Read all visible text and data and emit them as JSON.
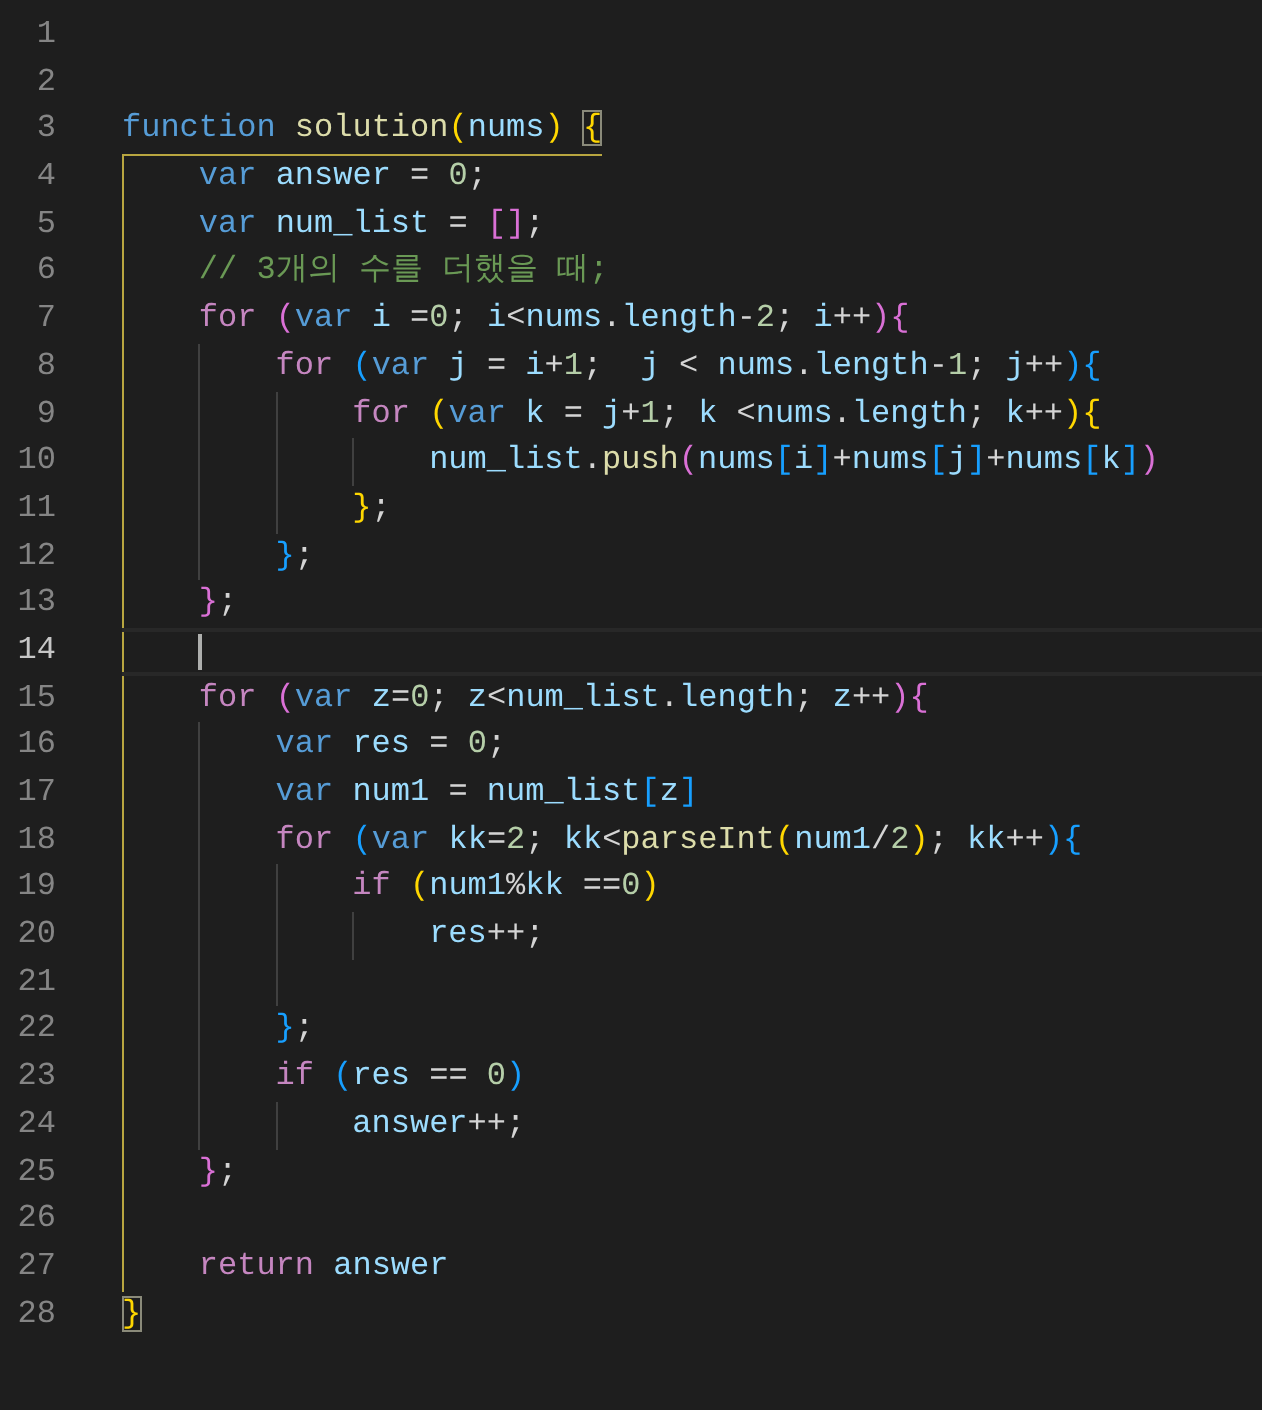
{
  "editor": {
    "lines": [
      {
        "number": "1",
        "current": false
      },
      {
        "number": "2",
        "current": false
      },
      {
        "number": "3",
        "current": false,
        "tokens": [
          {
            "kind": "storage",
            "text": "function"
          },
          {
            "kind": "space"
          },
          {
            "kind": "function",
            "text": "solution"
          },
          {
            "kind": "paren1",
            "text": "("
          },
          {
            "kind": "variable",
            "text": "nums"
          },
          {
            "kind": "paren1",
            "text": ")"
          },
          {
            "kind": "space"
          },
          {
            "kind": "paren1",
            "text": "{",
            "matched": true
          }
        ],
        "children": [
          {
            "number": "4",
            "current": false,
            "tokens": [
              {
                "kind": "storage",
                "text": "var"
              },
              {
                "kind": "space"
              },
              {
                "kind": "variable",
                "text": "answer"
              },
              {
                "kind": "plain",
                "text": " = "
              },
              {
                "kind": "number",
                "text": "0"
              },
              {
                "kind": "plain",
                "text": ";"
              }
            ]
          },
          {
            "number": "5",
            "current": false,
            "tokens": [
              {
                "kind": "storage",
                "text": "var"
              },
              {
                "kind": "space"
              },
              {
                "kind": "variable",
                "text": "num_list"
              },
              {
                "kind": "plain",
                "text": " = "
              },
              {
                "kind": "paren2",
                "text": "[]"
              },
              {
                "kind": "plain",
                "text": ";"
              }
            ]
          },
          {
            "number": "6",
            "current": false,
            "tokens": [
              {
                "kind": "comment",
                "text": "// 3개의 수를 더했을 때;"
              }
            ]
          },
          {
            "number": "7",
            "current": false,
            "tokens": [
              {
                "kind": "control",
                "text": "for"
              },
              {
                "kind": "space"
              },
              {
                "kind": "paren2",
                "text": "("
              },
              {
                "kind": "storage",
                "text": "var"
              },
              {
                "kind": "space"
              },
              {
                "kind": "variable",
                "text": "i"
              },
              {
                "kind": "plain",
                "text": " ="
              },
              {
                "kind": "number",
                "text": "0"
              },
              {
                "kind": "plain",
                "text": "; "
              },
              {
                "kind": "variable",
                "text": "i"
              },
              {
                "kind": "plain",
                "text": "<"
              },
              {
                "kind": "variable",
                "text": "nums"
              },
              {
                "kind": "plain",
                "text": "."
              },
              {
                "kind": "variable",
                "text": "length"
              },
              {
                "kind": "plain",
                "text": "-"
              },
              {
                "kind": "number",
                "text": "2"
              },
              {
                "kind": "plain",
                "text": "; "
              },
              {
                "kind": "variable",
                "text": "i"
              },
              {
                "kind": "plain",
                "text": "++"
              },
              {
                "kind": "paren2",
                "text": "){"
              }
            ],
            "children": [
              {
                "number": "8",
                "current": false,
                "tokens": [
                  {
                    "kind": "control",
                    "text": "for"
                  },
                  {
                    "kind": "space"
                  },
                  {
                    "kind": "paren3",
                    "text": "("
                  },
                  {
                    "kind": "storage",
                    "text": "var"
                  },
                  {
                    "kind": "space"
                  },
                  {
                    "kind": "variable",
                    "text": "j"
                  },
                  {
                    "kind": "plain",
                    "text": " = "
                  },
                  {
                    "kind": "variable",
                    "text": "i"
                  },
                  {
                    "kind": "plain",
                    "text": "+"
                  },
                  {
                    "kind": "number",
                    "text": "1"
                  },
                  {
                    "kind": "plain",
                    "text": ";  "
                  },
                  {
                    "kind": "variable",
                    "text": "j"
                  },
                  {
                    "kind": "plain",
                    "text": " < "
                  },
                  {
                    "kind": "variable",
                    "text": "nums"
                  },
                  {
                    "kind": "plain",
                    "text": "."
                  },
                  {
                    "kind": "variable",
                    "text": "length"
                  },
                  {
                    "kind": "plain",
                    "text": "-"
                  },
                  {
                    "kind": "number",
                    "text": "1"
                  },
                  {
                    "kind": "plain",
                    "text": "; "
                  },
                  {
                    "kind": "variable",
                    "text": "j"
                  },
                  {
                    "kind": "plain",
                    "text": "++"
                  },
                  {
                    "kind": "paren3",
                    "text": "){"
                  }
                ],
                "children": [
                  {
                    "number": "9",
                    "current": false,
                    "tokens": [
                      {
                        "kind": "control",
                        "text": "for"
                      },
                      {
                        "kind": "space"
                      },
                      {
                        "kind": "paren1",
                        "text": "("
                      },
                      {
                        "kind": "storage",
                        "text": "var"
                      },
                      {
                        "kind": "space"
                      },
                      {
                        "kind": "variable",
                        "text": "k"
                      },
                      {
                        "kind": "plain",
                        "text": " = "
                      },
                      {
                        "kind": "variable",
                        "text": "j"
                      },
                      {
                        "kind": "plain",
                        "text": "+"
                      },
                      {
                        "kind": "number",
                        "text": "1"
                      },
                      {
                        "kind": "plain",
                        "text": "; "
                      },
                      {
                        "kind": "variable",
                        "text": "k"
                      },
                      {
                        "kind": "plain",
                        "text": " <"
                      },
                      {
                        "kind": "variable",
                        "text": "nums"
                      },
                      {
                        "kind": "plain",
                        "text": "."
                      },
                      {
                        "kind": "variable",
                        "text": "length"
                      },
                      {
                        "kind": "plain",
                        "text": "; "
                      },
                      {
                        "kind": "variable",
                        "text": "k"
                      },
                      {
                        "kind": "plain",
                        "text": "++"
                      },
                      {
                        "kind": "paren1",
                        "text": "){"
                      }
                    ],
                    "children": [
                      {
                        "number": "10",
                        "current": false,
                        "tokens": [
                          {
                            "kind": "variable",
                            "text": "num_list"
                          },
                          {
                            "kind": "plain",
                            "text": "."
                          },
                          {
                            "kind": "function",
                            "text": "push"
                          },
                          {
                            "kind": "paren2",
                            "text": "("
                          },
                          {
                            "kind": "variable",
                            "text": "nums"
                          },
                          {
                            "kind": "paren3",
                            "text": "["
                          },
                          {
                            "kind": "variable",
                            "text": "i"
                          },
                          {
                            "kind": "paren3",
                            "text": "]"
                          },
                          {
                            "kind": "plain",
                            "text": "+"
                          },
                          {
                            "kind": "variable",
                            "text": "nums"
                          },
                          {
                            "kind": "paren3",
                            "text": "["
                          },
                          {
                            "kind": "variable",
                            "text": "j"
                          },
                          {
                            "kind": "paren3",
                            "text": "]"
                          },
                          {
                            "kind": "plain",
                            "text": "+"
                          },
                          {
                            "kind": "variable",
                            "text": "nums"
                          },
                          {
                            "kind": "paren3",
                            "text": "["
                          },
                          {
                            "kind": "variable",
                            "text": "k"
                          },
                          {
                            "kind": "paren3",
                            "text": "]"
                          },
                          {
                            "kind": "paren2",
                            "text": ")"
                          }
                        ]
                      }
                    ]
                  },
                  {
                    "number": "11",
                    "current": false,
                    "tokens": [
                      {
                        "kind": "paren1",
                        "text": "}"
                      },
                      {
                        "kind": "plain",
                        "text": ";"
                      }
                    ]
                  }
                ]
              },
              {
                "number": "12",
                "current": false,
                "tokens": [
                  {
                    "kind": "paren3",
                    "text": "}"
                  },
                  {
                    "kind": "plain",
                    "text": ";"
                  }
                ]
              }
            ]
          },
          {
            "number": "13",
            "current": false,
            "tokens": [
              {
                "kind": "paren2",
                "text": "}"
              },
              {
                "kind": "plain",
                "text": ";"
              }
            ]
          },
          {
            "number": "14",
            "current": true
          },
          {
            "number": "15",
            "current": false,
            "tokens": [
              {
                "kind": "control",
                "text": "for"
              },
              {
                "kind": "space"
              },
              {
                "kind": "paren2",
                "text": "("
              },
              {
                "kind": "storage",
                "text": "var"
              },
              {
                "kind": "space"
              },
              {
                "kind": "variable",
                "text": "z"
              },
              {
                "kind": "plain",
                "text": "="
              },
              {
                "kind": "number",
                "text": "0"
              },
              {
                "kind": "plain",
                "text": "; "
              },
              {
                "kind": "variable",
                "text": "z"
              },
              {
                "kind": "plain",
                "text": "<"
              },
              {
                "kind": "variable",
                "text": "num_list"
              },
              {
                "kind": "plain",
                "text": "."
              },
              {
                "kind": "variable",
                "text": "length"
              },
              {
                "kind": "plain",
                "text": "; "
              },
              {
                "kind": "variable",
                "text": "z"
              },
              {
                "kind": "plain",
                "text": "++"
              },
              {
                "kind": "paren2",
                "text": "){"
              }
            ],
            "children": [
              {
                "number": "16",
                "current": false,
                "tokens": [
                  {
                    "kind": "storage",
                    "text": "var"
                  },
                  {
                    "kind": "space"
                  },
                  {
                    "kind": "variable",
                    "text": "res"
                  },
                  {
                    "kind": "plain",
                    "text": " = "
                  },
                  {
                    "kind": "number",
                    "text": "0"
                  },
                  {
                    "kind": "plain",
                    "text": ";"
                  }
                ]
              },
              {
                "number": "17",
                "current": false,
                "tokens": [
                  {
                    "kind": "storage",
                    "text": "var"
                  },
                  {
                    "kind": "space"
                  },
                  {
                    "kind": "variable",
                    "text": "num1"
                  },
                  {
                    "kind": "plain",
                    "text": " = "
                  },
                  {
                    "kind": "variable",
                    "text": "num_list"
                  },
                  {
                    "kind": "paren3",
                    "text": "["
                  },
                  {
                    "kind": "variable",
                    "text": "z"
                  },
                  {
                    "kind": "paren3",
                    "text": "]"
                  }
                ]
              },
              {
                "number": "18",
                "current": false,
                "tokens": [
                  {
                    "kind": "control",
                    "text": "for"
                  },
                  {
                    "kind": "space"
                  },
                  {
                    "kind": "paren3",
                    "text": "("
                  },
                  {
                    "kind": "storage",
                    "text": "var"
                  },
                  {
                    "kind": "space"
                  },
                  {
                    "kind": "variable",
                    "text": "kk"
                  },
                  {
                    "kind": "plain",
                    "text": "="
                  },
                  {
                    "kind": "number",
                    "text": "2"
                  },
                  {
                    "kind": "plain",
                    "text": "; "
                  },
                  {
                    "kind": "variable",
                    "text": "kk"
                  },
                  {
                    "kind": "plain",
                    "text": "<"
                  },
                  {
                    "kind": "function",
                    "text": "parseInt"
                  },
                  {
                    "kind": "paren1",
                    "text": "("
                  },
                  {
                    "kind": "variable",
                    "text": "num1"
                  },
                  {
                    "kind": "plain",
                    "text": "/"
                  },
                  {
                    "kind": "number",
                    "text": "2"
                  },
                  {
                    "kind": "paren1",
                    "text": ")"
                  },
                  {
                    "kind": "plain",
                    "text": "; "
                  },
                  {
                    "kind": "variable",
                    "text": "kk"
                  },
                  {
                    "kind": "plain",
                    "text": "++"
                  },
                  {
                    "kind": "paren3",
                    "text": "){"
                  }
                ],
                "children": [
                  {
                    "number": "19",
                    "current": false,
                    "tokens": [
                      {
                        "kind": "control",
                        "text": "if"
                      },
                      {
                        "kind": "space"
                      },
                      {
                        "kind": "paren1",
                        "text": "("
                      },
                      {
                        "kind": "variable",
                        "text": "num1"
                      },
                      {
                        "kind": "plain",
                        "text": "%"
                      },
                      {
                        "kind": "variable",
                        "text": "kk"
                      },
                      {
                        "kind": "plain",
                        "text": " =="
                      },
                      {
                        "kind": "number",
                        "text": "0"
                      },
                      {
                        "kind": "paren1",
                        "text": ")"
                      }
                    ],
                    "children": [
                      {
                        "number": "20",
                        "current": false,
                        "tokens": [
                          {
                            "kind": "variable",
                            "text": "res"
                          },
                          {
                            "kind": "plain",
                            "text": "++;"
                          }
                        ]
                      }
                    ]
                  },
                  {
                    "number": "21",
                    "current": false
                  }
                ]
              },
              {
                "number": "22",
                "current": false,
                "tokens": [
                  {
                    "kind": "paren3",
                    "text": "}"
                  },
                  {
                    "kind": "plain",
                    "text": ";"
                  }
                ]
              },
              {
                "number": "23",
                "current": false,
                "tokens": [
                  {
                    "kind": "control",
                    "text": "if"
                  },
                  {
                    "kind": "space"
                  },
                  {
                    "kind": "paren3",
                    "text": "("
                  },
                  {
                    "kind": "variable",
                    "text": "res"
                  },
                  {
                    "kind": "plain",
                    "text": " == "
                  },
                  {
                    "kind": "number",
                    "text": "0"
                  },
                  {
                    "kind": "paren3",
                    "text": ")"
                  }
                ],
                "children": [
                  {
                    "number": "24",
                    "current": false,
                    "tokens": [
                      {
                        "kind": "variable",
                        "text": "answer"
                      },
                      {
                        "kind": "plain",
                        "text": "++;"
                      }
                    ]
                  }
                ]
              }
            ]
          },
          {
            "number": "25",
            "current": false,
            "tokens": [
              {
                "kind": "paren2",
                "text": "}"
              },
              {
                "kind": "plain",
                "text": ";"
              }
            ]
          },
          {
            "number": "26",
            "current": false
          },
          {
            "number": "27",
            "current": false,
            "tokens": [
              {
                "kind": "control",
                "text": "return"
              },
              {
                "kind": "space"
              },
              {
                "kind": "variable",
                "text": "answer"
              }
            ]
          }
        ]
      },
      {
        "number": "28",
        "current": false,
        "tokens": [
          {
            "kind": "paren1",
            "text": "}",
            "matched": true
          }
        ]
      }
    ]
  }
}
